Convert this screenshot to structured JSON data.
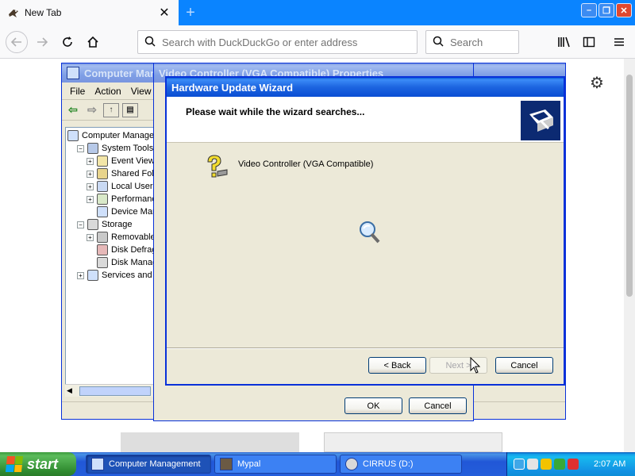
{
  "browser": {
    "tab_title": "New Tab",
    "url_placeholder": "Search with DuckDuckGo or enter address",
    "search_placeholder": "Search"
  },
  "computer_management": {
    "title": "Computer Management",
    "menu": [
      "File",
      "Action",
      "View"
    ],
    "tree": [
      {
        "label": "Computer Management (Local)",
        "level": 0,
        "expander": ""
      },
      {
        "label": "System Tools",
        "level": 1,
        "expander": "−"
      },
      {
        "label": "Event Viewer",
        "level": 2,
        "expander": "+"
      },
      {
        "label": "Shared Folders",
        "level": 2,
        "expander": "+"
      },
      {
        "label": "Local Users and Groups",
        "level": 2,
        "expander": "+"
      },
      {
        "label": "Performance Logs and Alerts",
        "level": 2,
        "expander": "+"
      },
      {
        "label": "Device Manager",
        "level": 2,
        "expander": ""
      },
      {
        "label": "Storage",
        "level": 1,
        "expander": "−"
      },
      {
        "label": "Removable Storage",
        "level": 2,
        "expander": "+"
      },
      {
        "label": "Disk Defragmenter",
        "level": 2,
        "expander": ""
      },
      {
        "label": "Disk Management",
        "level": 2,
        "expander": ""
      },
      {
        "label": "Services and Applications",
        "level": 1,
        "expander": "+"
      }
    ]
  },
  "properties": {
    "title": "Video Controller (VGA Compatible) Properties",
    "ok_label": "OK",
    "cancel_label": "Cancel"
  },
  "wizard": {
    "title": "Hardware Update Wizard",
    "header_text": "Please wait while the wizard searches...",
    "device_name": "Video Controller (VGA Compatible)",
    "back_label": "< Back",
    "next_label": "Next >",
    "cancel_label": "Cancel"
  },
  "taskbar": {
    "start_label": "start",
    "tasks": [
      "Computer Management",
      "Mypal",
      "CIRRUS (D:)"
    ],
    "clock": "2:07 AM"
  }
}
